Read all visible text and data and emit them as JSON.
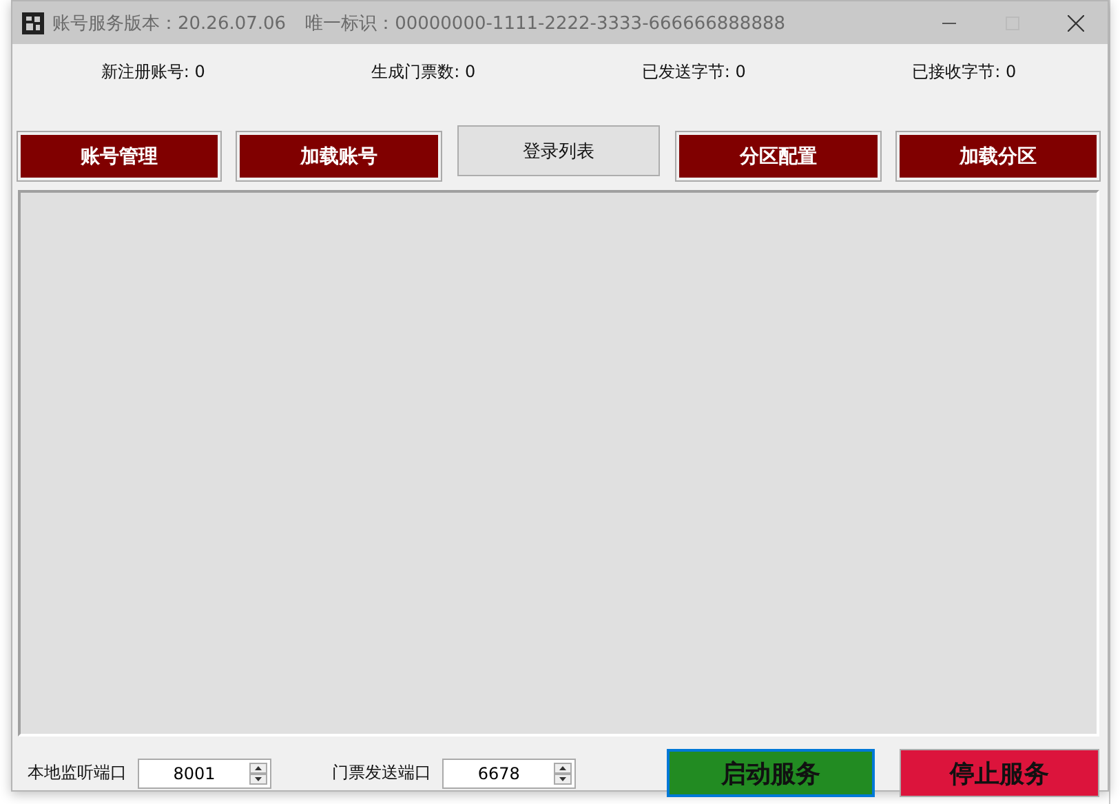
{
  "window": {
    "title": "账号服务版本：20.26.07.06",
    "identifier": "唯一标识：00000000-1111-2222-3333-666666888888",
    "active": false,
    "maximize_disabled": true
  },
  "stats": [
    "新注册账号: 0",
    "生成门票数: 0",
    "已发送字节: 0",
    "已接收字节: 0"
  ],
  "buttons": [
    {
      "label": "账号管理",
      "kind": "dark"
    },
    {
      "label": "加载账号",
      "kind": "dark"
    },
    {
      "label": "登录列表",
      "kind": "flat"
    },
    {
      "label": "分区配置",
      "kind": "dark"
    },
    {
      "label": "加载分区",
      "kind": "dark"
    }
  ],
  "ports": [
    {
      "label": "本地监听端口",
      "value": "8001"
    },
    {
      "label": "门票发送端口",
      "value": "6678"
    }
  ],
  "actions": [
    {
      "label": "启动服务",
      "kind": "start",
      "focused": true
    },
    {
      "label": "停止服务",
      "kind": "stop",
      "focused": false
    }
  ]
}
